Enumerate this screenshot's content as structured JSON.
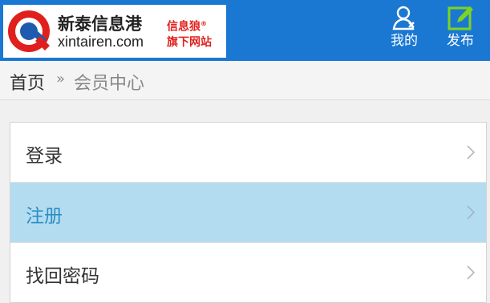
{
  "header": {
    "logo_title": "新泰信息港",
    "logo_domain": "xintairen.com",
    "logo_tag_line1": "信息狼",
    "logo_tag_line2": "旗下网站",
    "buttons": [
      {
        "label": "我的",
        "icon": "user-icon"
      },
      {
        "label": "发布",
        "icon": "edit-icon"
      }
    ]
  },
  "breadcrumb": {
    "home": "首页",
    "separator": "»",
    "current": "会员中心"
  },
  "menu": {
    "items": [
      {
        "label": "登录",
        "active": false
      },
      {
        "label": "注册",
        "active": true
      },
      {
        "label": "找回密码",
        "active": false
      }
    ]
  },
  "colors": {
    "header_bg": "#1a78d2",
    "active_row_bg": "#b4dcf0",
    "post_icon": "#7ed321",
    "logo_red": "#e0201c",
    "logo_blue": "#1e5bb0"
  }
}
